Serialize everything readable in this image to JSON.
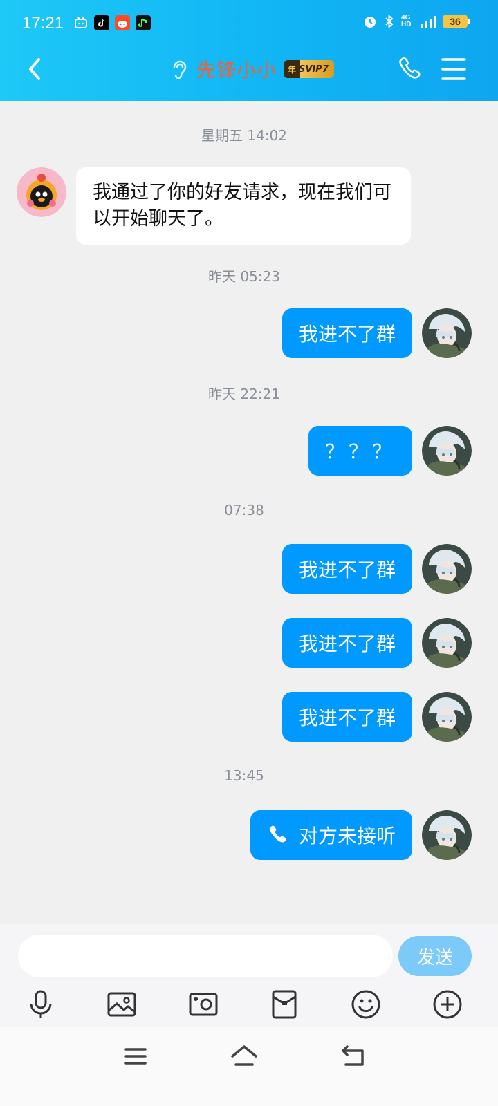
{
  "status_bar": {
    "time": "17:21",
    "network_label": "4G HD",
    "battery": "36"
  },
  "header": {
    "title": "先锋小小",
    "badge_year": "年",
    "badge_text": "SVIP7",
    "title_color": "#ff5a2b"
  },
  "chat": {
    "timestamps": [
      "星期五 14:02",
      "昨天 05:23",
      "昨天 22:21",
      "07:38",
      "13:45"
    ],
    "incoming": [
      {
        "text": "我通过了你的好友请求，现在我们可以开始聊天了。"
      }
    ],
    "outgoing": [
      {
        "text": "我进不了群"
      },
      {
        "text": "？？？"
      },
      {
        "text": "我进不了群"
      },
      {
        "text": "我进不了群"
      },
      {
        "text": "我进不了群"
      },
      {
        "text": "对方未接听",
        "icon": "phone-icon"
      }
    ]
  },
  "input": {
    "placeholder": "",
    "send_label": "发送"
  },
  "colors": {
    "header_gradient_start": "#1ec8f7",
    "bubble_out": "#0099ff",
    "send_disabled": "#7ccaf7"
  }
}
